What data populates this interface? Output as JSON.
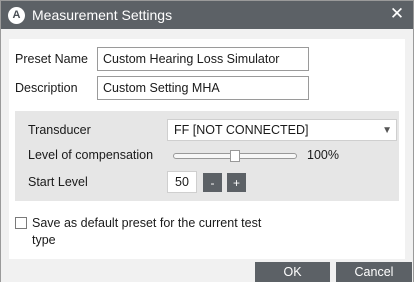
{
  "window": {
    "title": "Measurement Settings",
    "app_icon_letter": "A",
    "close_glyph": "✕",
    "icons": {
      "app": "app-logo-icon",
      "close": "close-icon"
    }
  },
  "form": {
    "preset_name_label": "Preset Name",
    "preset_name_value": "Custom Hearing Loss Simulator",
    "description_label": "Description",
    "description_value": "Custom Setting MHA"
  },
  "settings": {
    "transducer_label": "Transducer",
    "transducer_value": "FF [NOT CONNECTED]",
    "level_comp_label": "Level of compensation",
    "level_comp_value": "100%",
    "level_comp_slider_position": 0.5,
    "start_level_label": "Start Level",
    "start_level_value": "50",
    "decrement_label": "-",
    "increment_label": "+"
  },
  "default_preset": {
    "checked": false,
    "label_line1": "Save as default preset for the current test",
    "label_line2": "type"
  },
  "footer": {
    "ok_label": "OK",
    "cancel_label": "Cancel"
  },
  "colors": {
    "titlebar": "#5c6166",
    "button": "#5c6166",
    "panel": "#e6e6e6",
    "dialog_bg": "#f1f1f1"
  }
}
